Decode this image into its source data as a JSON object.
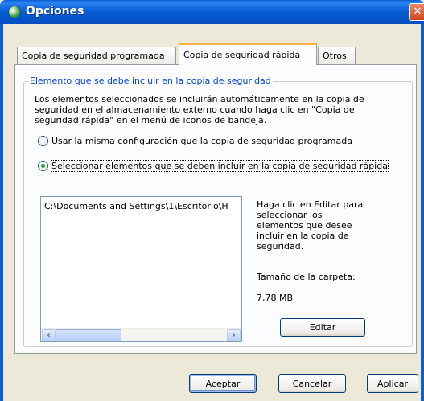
{
  "window": {
    "title": "Opciones",
    "close_glyph": "✕"
  },
  "tabs": [
    {
      "label": "Copia de seguridad programada",
      "active": false
    },
    {
      "label": "Copia de seguridad rápida",
      "active": true
    },
    {
      "label": "Otros",
      "active": false
    }
  ],
  "group": {
    "legend": "Elemento que se debe incluir en la copia de seguridad",
    "description": "Los elementos seleccionados se incluirán automáticamente en la copia de seguridad en el almacenamiento externo cuando haga clic en \"Copia de seguridad rápida\" en el menú de iconos de bandeja.",
    "radio_same": "Usar la misma configuración que la copia de seguridad programada",
    "radio_select": "Seleccionar elementos que se deben incluir en la copia de seguridad rápida",
    "selected_option": "radio_select"
  },
  "list": {
    "items": [
      "C:\\Documents and Settings\\1\\Escritorio\\H"
    ],
    "scroll_left": "‹",
    "scroll_right": "›"
  },
  "side": {
    "hint": "Haga clic en Editar para seleccionar los elementos que desee incluir en la copia de seguridad.",
    "size_label": "Tamaño de la carpeta:",
    "size_value": "7,78 MB",
    "edit_button": "Editar"
  },
  "footer": {
    "accept": "Aceptar",
    "cancel": "Cancelar",
    "apply": "Aplicar"
  },
  "colors": {
    "titlebar": "#0a5fd6",
    "legend": "#0046d5",
    "panel": "#fcfcfe",
    "dialog": "#ece9d8"
  }
}
